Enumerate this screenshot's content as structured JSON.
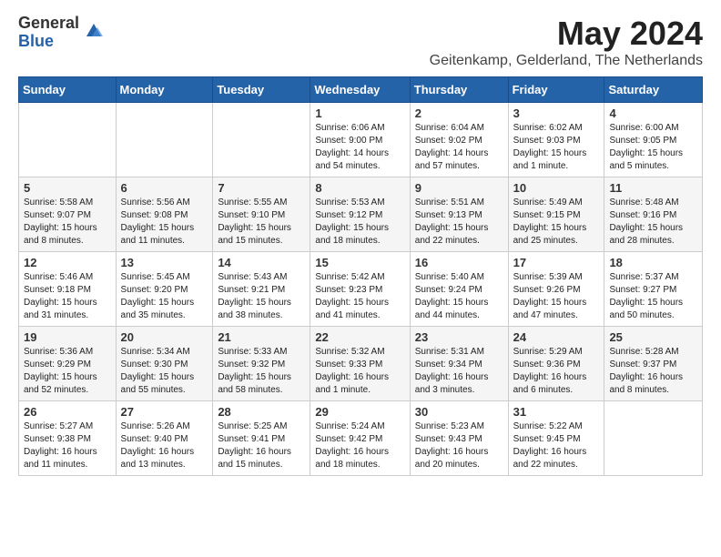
{
  "logo": {
    "general": "General",
    "blue": "Blue"
  },
  "header": {
    "month_title": "May 2024",
    "location": "Geitenkamp, Gelderland, The Netherlands"
  },
  "weekdays": [
    "Sunday",
    "Monday",
    "Tuesday",
    "Wednesday",
    "Thursday",
    "Friday",
    "Saturday"
  ],
  "weeks": [
    [
      {
        "day": "",
        "info": ""
      },
      {
        "day": "",
        "info": ""
      },
      {
        "day": "",
        "info": ""
      },
      {
        "day": "1",
        "info": "Sunrise: 6:06 AM\nSunset: 9:00 PM\nDaylight: 14 hours\nand 54 minutes."
      },
      {
        "day": "2",
        "info": "Sunrise: 6:04 AM\nSunset: 9:02 PM\nDaylight: 14 hours\nand 57 minutes."
      },
      {
        "day": "3",
        "info": "Sunrise: 6:02 AM\nSunset: 9:03 PM\nDaylight: 15 hours\nand 1 minute."
      },
      {
        "day": "4",
        "info": "Sunrise: 6:00 AM\nSunset: 9:05 PM\nDaylight: 15 hours\nand 5 minutes."
      }
    ],
    [
      {
        "day": "5",
        "info": "Sunrise: 5:58 AM\nSunset: 9:07 PM\nDaylight: 15 hours\nand 8 minutes."
      },
      {
        "day": "6",
        "info": "Sunrise: 5:56 AM\nSunset: 9:08 PM\nDaylight: 15 hours\nand 11 minutes."
      },
      {
        "day": "7",
        "info": "Sunrise: 5:55 AM\nSunset: 9:10 PM\nDaylight: 15 hours\nand 15 minutes."
      },
      {
        "day": "8",
        "info": "Sunrise: 5:53 AM\nSunset: 9:12 PM\nDaylight: 15 hours\nand 18 minutes."
      },
      {
        "day": "9",
        "info": "Sunrise: 5:51 AM\nSunset: 9:13 PM\nDaylight: 15 hours\nand 22 minutes."
      },
      {
        "day": "10",
        "info": "Sunrise: 5:49 AM\nSunset: 9:15 PM\nDaylight: 15 hours\nand 25 minutes."
      },
      {
        "day": "11",
        "info": "Sunrise: 5:48 AM\nSunset: 9:16 PM\nDaylight: 15 hours\nand 28 minutes."
      }
    ],
    [
      {
        "day": "12",
        "info": "Sunrise: 5:46 AM\nSunset: 9:18 PM\nDaylight: 15 hours\nand 31 minutes."
      },
      {
        "day": "13",
        "info": "Sunrise: 5:45 AM\nSunset: 9:20 PM\nDaylight: 15 hours\nand 35 minutes."
      },
      {
        "day": "14",
        "info": "Sunrise: 5:43 AM\nSunset: 9:21 PM\nDaylight: 15 hours\nand 38 minutes."
      },
      {
        "day": "15",
        "info": "Sunrise: 5:42 AM\nSunset: 9:23 PM\nDaylight: 15 hours\nand 41 minutes."
      },
      {
        "day": "16",
        "info": "Sunrise: 5:40 AM\nSunset: 9:24 PM\nDaylight: 15 hours\nand 44 minutes."
      },
      {
        "day": "17",
        "info": "Sunrise: 5:39 AM\nSunset: 9:26 PM\nDaylight: 15 hours\nand 47 minutes."
      },
      {
        "day": "18",
        "info": "Sunrise: 5:37 AM\nSunset: 9:27 PM\nDaylight: 15 hours\nand 50 minutes."
      }
    ],
    [
      {
        "day": "19",
        "info": "Sunrise: 5:36 AM\nSunset: 9:29 PM\nDaylight: 15 hours\nand 52 minutes."
      },
      {
        "day": "20",
        "info": "Sunrise: 5:34 AM\nSunset: 9:30 PM\nDaylight: 15 hours\nand 55 minutes."
      },
      {
        "day": "21",
        "info": "Sunrise: 5:33 AM\nSunset: 9:32 PM\nDaylight: 15 hours\nand 58 minutes."
      },
      {
        "day": "22",
        "info": "Sunrise: 5:32 AM\nSunset: 9:33 PM\nDaylight: 16 hours\nand 1 minute."
      },
      {
        "day": "23",
        "info": "Sunrise: 5:31 AM\nSunset: 9:34 PM\nDaylight: 16 hours\nand 3 minutes."
      },
      {
        "day": "24",
        "info": "Sunrise: 5:29 AM\nSunset: 9:36 PM\nDaylight: 16 hours\nand 6 minutes."
      },
      {
        "day": "25",
        "info": "Sunrise: 5:28 AM\nSunset: 9:37 PM\nDaylight: 16 hours\nand 8 minutes."
      }
    ],
    [
      {
        "day": "26",
        "info": "Sunrise: 5:27 AM\nSunset: 9:38 PM\nDaylight: 16 hours\nand 11 minutes."
      },
      {
        "day": "27",
        "info": "Sunrise: 5:26 AM\nSunset: 9:40 PM\nDaylight: 16 hours\nand 13 minutes."
      },
      {
        "day": "28",
        "info": "Sunrise: 5:25 AM\nSunset: 9:41 PM\nDaylight: 16 hours\nand 15 minutes."
      },
      {
        "day": "29",
        "info": "Sunrise: 5:24 AM\nSunset: 9:42 PM\nDaylight: 16 hours\nand 18 minutes."
      },
      {
        "day": "30",
        "info": "Sunrise: 5:23 AM\nSunset: 9:43 PM\nDaylight: 16 hours\nand 20 minutes."
      },
      {
        "day": "31",
        "info": "Sunrise: 5:22 AM\nSunset: 9:45 PM\nDaylight: 16 hours\nand 22 minutes."
      },
      {
        "day": "",
        "info": ""
      }
    ]
  ]
}
